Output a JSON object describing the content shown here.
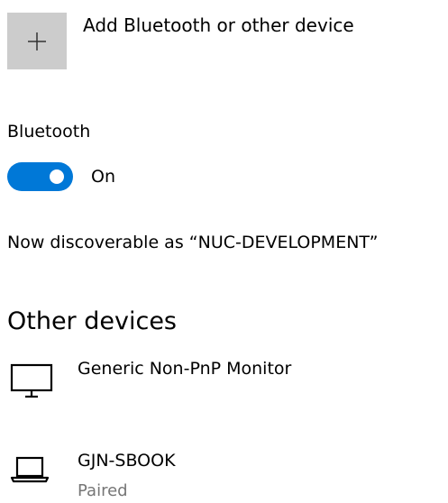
{
  "add_device": {
    "label": "Add Bluetooth or other device",
    "icon": "plus-icon",
    "tile_color": "#cccccc"
  },
  "bluetooth": {
    "heading": "Bluetooth",
    "toggle_state": "On",
    "toggle_on": true,
    "accent_color": "#0078d7"
  },
  "discoverable_text": "Now discoverable as “NUC-DEVELOPMENT”",
  "other_devices": {
    "title": "Other devices",
    "items": [
      {
        "name": "Generic Non-PnP Monitor",
        "icon": "monitor-icon",
        "status": ""
      },
      {
        "name": "GJN-SBOOK",
        "icon": "laptop-icon",
        "status": "Paired"
      }
    ]
  }
}
